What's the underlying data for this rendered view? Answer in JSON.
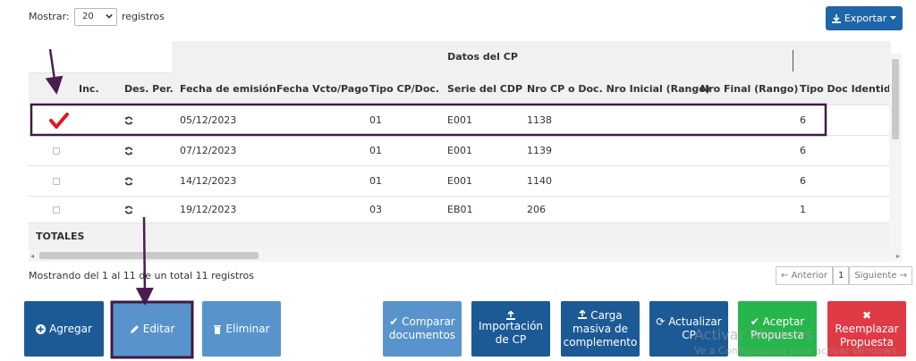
{
  "top": {
    "show_label": "Mostrar:",
    "page_size": "20",
    "records_label": "registros",
    "export_label": "Exportar"
  },
  "table": {
    "group_header": "Datos del CP",
    "columns": [
      "Inc.",
      "Des. Per.",
      "Fecha de emisión",
      "Fecha Vcto/Pago",
      "Tipo CP/Doc.",
      "Serie del CDP",
      "Nro CP o Doc. Nro Inicial (Rango)",
      "Nro Final (Rango)",
      "Tipo Doc Identidad"
    ],
    "rows": [
      {
        "fecha": "05/12/2023",
        "vcto": "",
        "tipo": "01",
        "serie": "E001",
        "nro": "1138",
        "final": "",
        "tipodoc": "6",
        "checked": true
      },
      {
        "fecha": "07/12/2023",
        "vcto": "",
        "tipo": "01",
        "serie": "E001",
        "nro": "1139",
        "final": "",
        "tipodoc": "6",
        "checked": false
      },
      {
        "fecha": "14/12/2023",
        "vcto": "",
        "tipo": "01",
        "serie": "E001",
        "nro": "1140",
        "final": "",
        "tipodoc": "6",
        "checked": false
      },
      {
        "fecha": "19/12/2023",
        "vcto": "",
        "tipo": "03",
        "serie": "EB01",
        "nro": "206",
        "final": "",
        "tipodoc": "1",
        "checked": false
      }
    ],
    "totals_label": "TOTALES"
  },
  "footer": {
    "showing": "Mostrando del 1 al 11 de un total 11 registros",
    "prev": "Anterior",
    "page": "1",
    "next": "Siguiente"
  },
  "buttons": {
    "add": "Agregar",
    "edit": "Editar",
    "delete": "Eliminar",
    "compare": [
      "Comparar",
      "documentos"
    ],
    "import": [
      "Importación",
      "de CP"
    ],
    "bulk": [
      "Carga",
      "masiva de",
      "complemento"
    ],
    "update": [
      "Actualizar",
      "CP"
    ],
    "accept": [
      "Aceptar",
      "Propuesta"
    ],
    "replace": [
      "Reemplazar",
      "Propuesta"
    ]
  },
  "watermark": {
    "line1": "Activar Windows",
    "line2": "Ve a Configuración para activar Windows."
  },
  "colors": {
    "primary": "#1c5a96",
    "primary_light": "#5893cc",
    "success": "#26b64c",
    "danger": "#e03a45",
    "annotation": "#4a1d4f",
    "check": "#e0161f"
  }
}
